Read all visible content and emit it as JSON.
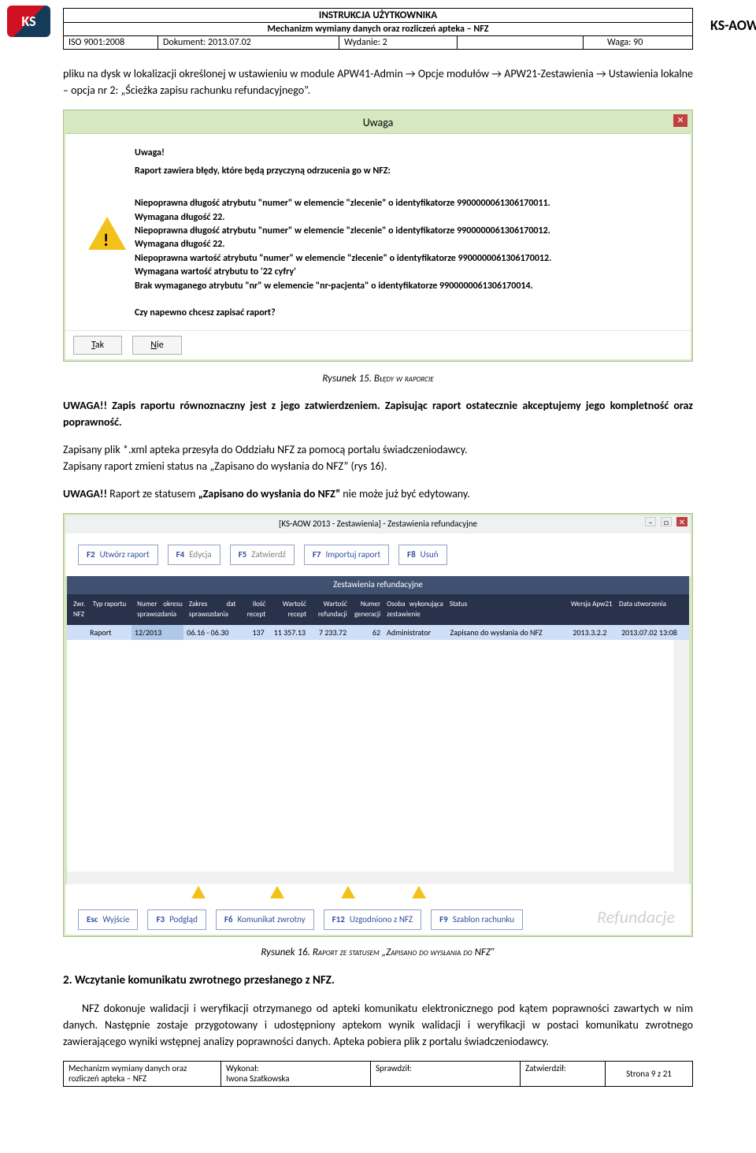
{
  "header": {
    "logo_text": "KS",
    "title1": "INSTRUKCJA UŻYTKOWNIKA",
    "title2": "Mechanizm wymiany danych oraz rozliczeń apteka – NFZ",
    "iso": "ISO 9001:2008",
    "dokument": "Dokument: 2013.07.02",
    "wydanie": "Wydanie: 2",
    "waga": "Waga: 90",
    "right": "KS-AOW"
  },
  "body": {
    "p1": "pliku na dysk w lokalizacji określonej w ustawieniu w module APW41-Admin → Opcje modułów → APW21-Zestawienia → Ustawienia lokalne – opcja nr 2: „Ścieżka zapisu rachunku refundacyjnego”.",
    "cap15_a": "Rysunek 15. ",
    "cap15_b": "Błędy w raporcie",
    "uwaga1": "UWAGA!! Zapis raportu równoznaczny jest z jego zatwierdzeniem. Zapisując raport ostatecznie akceptujemy jego kompletność oraz poprawność.",
    "p2a": "Zapisany plik *.xml apteka przesyła do Oddziału NFZ za pomocą portalu świadczeniodawcy.",
    "p2b": "Zapisany raport zmieni status na „Zapisano do wysłania do NFZ” (rys 16).",
    "uwaga2_a": "UWAGA!!",
    "uwaga2_b": " Raport ze statusem ",
    "uwaga2_c": "„Zapisano do wysłania do NFZ”",
    "uwaga2_d": " nie może już być edytowany.",
    "cap16_a": "Rysunek 16. ",
    "cap16_b": "Raport ze statusem „Zapisano do wysłania do NFZ”",
    "sec2": "2. Wczytanie komunikatu zwrotnego przesłanego z NFZ.",
    "p3": "NFZ dokonuje walidacji i weryfikacji otrzymanego od apteki komunikatu elektronicznego pod kątem poprawności zawartych w nim danych.  Następnie zostaje przygotowany i udostępniony aptekom wynik walidacji i weryfikacji w postaci komunikatu zwrotnego zawierającego wyniki wstępnej analizy poprawności danych. Apteka pobiera plik z portalu świadczeniodawcy."
  },
  "dialog": {
    "title": "Uwaga",
    "h1": "Uwaga!",
    "h2": "Raport zawiera błędy, które będą przyczyną odrzucenia go w NFZ:",
    "l1": "Niepoprawna długość atrybutu \"numer\" w elemencie \"zlecenie\" o identyfikatorze 9900000061306170011.",
    "l2": "Wymagana długość 22.",
    "l3": "Niepoprawna długość atrybutu \"numer\" w elemencie \"zlecenie\" o identyfikatorze 9900000061306170012.",
    "l4": "Wymagana długość 22.",
    "l5": "Niepoprawna wartość atrybutu \"numer\" w elemencie \"zlecenie\" o identyfikatorze 9900000061306170012.",
    "l6": "Wymagana wartość atrybutu to '22 cyfry'",
    "l7": "Brak wymaganego atrybutu \"nr\" w elemencie \"nr-pacjenta\" o identyfikatorze 9900000061306170014.",
    "q": "Czy napewno chcesz zapisać raport?",
    "tak": "Tak",
    "nie": "Nie"
  },
  "app": {
    "title": "[KS-AOW 2013 - Zestawienia] - Zestawienia refundacyjne",
    "toolbar_top": [
      {
        "key": "F2",
        "label": "Utwórz raport"
      },
      {
        "key": "F4",
        "label": "Edycja"
      },
      {
        "key": "F5",
        "label": "Zatwierdź"
      },
      {
        "key": "F7",
        "label": "Importuj raport"
      },
      {
        "key": "F8",
        "label": "Usuń"
      }
    ],
    "toolbar_bottom": [
      {
        "key": "Esc",
        "label": "Wyjście"
      },
      {
        "key": "F3",
        "label": "Podgląd"
      },
      {
        "key": "F6",
        "label": "Komunikat zwrotny"
      },
      {
        "key": "F12",
        "label": "Uzgodniono z NFZ"
      },
      {
        "key": "F9",
        "label": "Szablon rachunku"
      }
    ],
    "table": {
      "title": "Zestawienia refundacyjne",
      "headers": {
        "zw": "Zwr. NFZ",
        "typ": "Typ raportu",
        "okres": "Numer okresu sprawozdania",
        "zakres": "Zakres dat sprawozdania",
        "ilosc": "Ilość recept",
        "wrec": "Wartość recept",
        "wref": "Wartość refundacji",
        "gen": "Numer generacji",
        "osoba": "Osoba wykonująca zestawienie",
        "status": "Status",
        "ver": "Wersja Apw21",
        "data": "Data utworzenia"
      },
      "row": {
        "zw": "",
        "typ": "Raport",
        "okres": "12/2013",
        "zakres": "06.16 - 06.30",
        "ilosc": "137",
        "wrec": "11 357.13",
        "wref": "7 233.72",
        "gen": "62",
        "osoba": "Administrator",
        "status": "Zapisano do wysłania do NFZ",
        "ver": "2013.3.2.2",
        "data": "2013.07.02 13:08"
      }
    },
    "watermark": "Refundacje"
  },
  "footer": {
    "c1a": "Mechanizm wymiany danych oraz",
    "c1b": "rozliczeń apteka – NFZ",
    "c2a": "Wykonał:",
    "c2b": "Iwona Szatkowska",
    "c3": "Sprawdził:",
    "c4": "Zatwierdził:",
    "c5": "Strona 9 z 21"
  }
}
